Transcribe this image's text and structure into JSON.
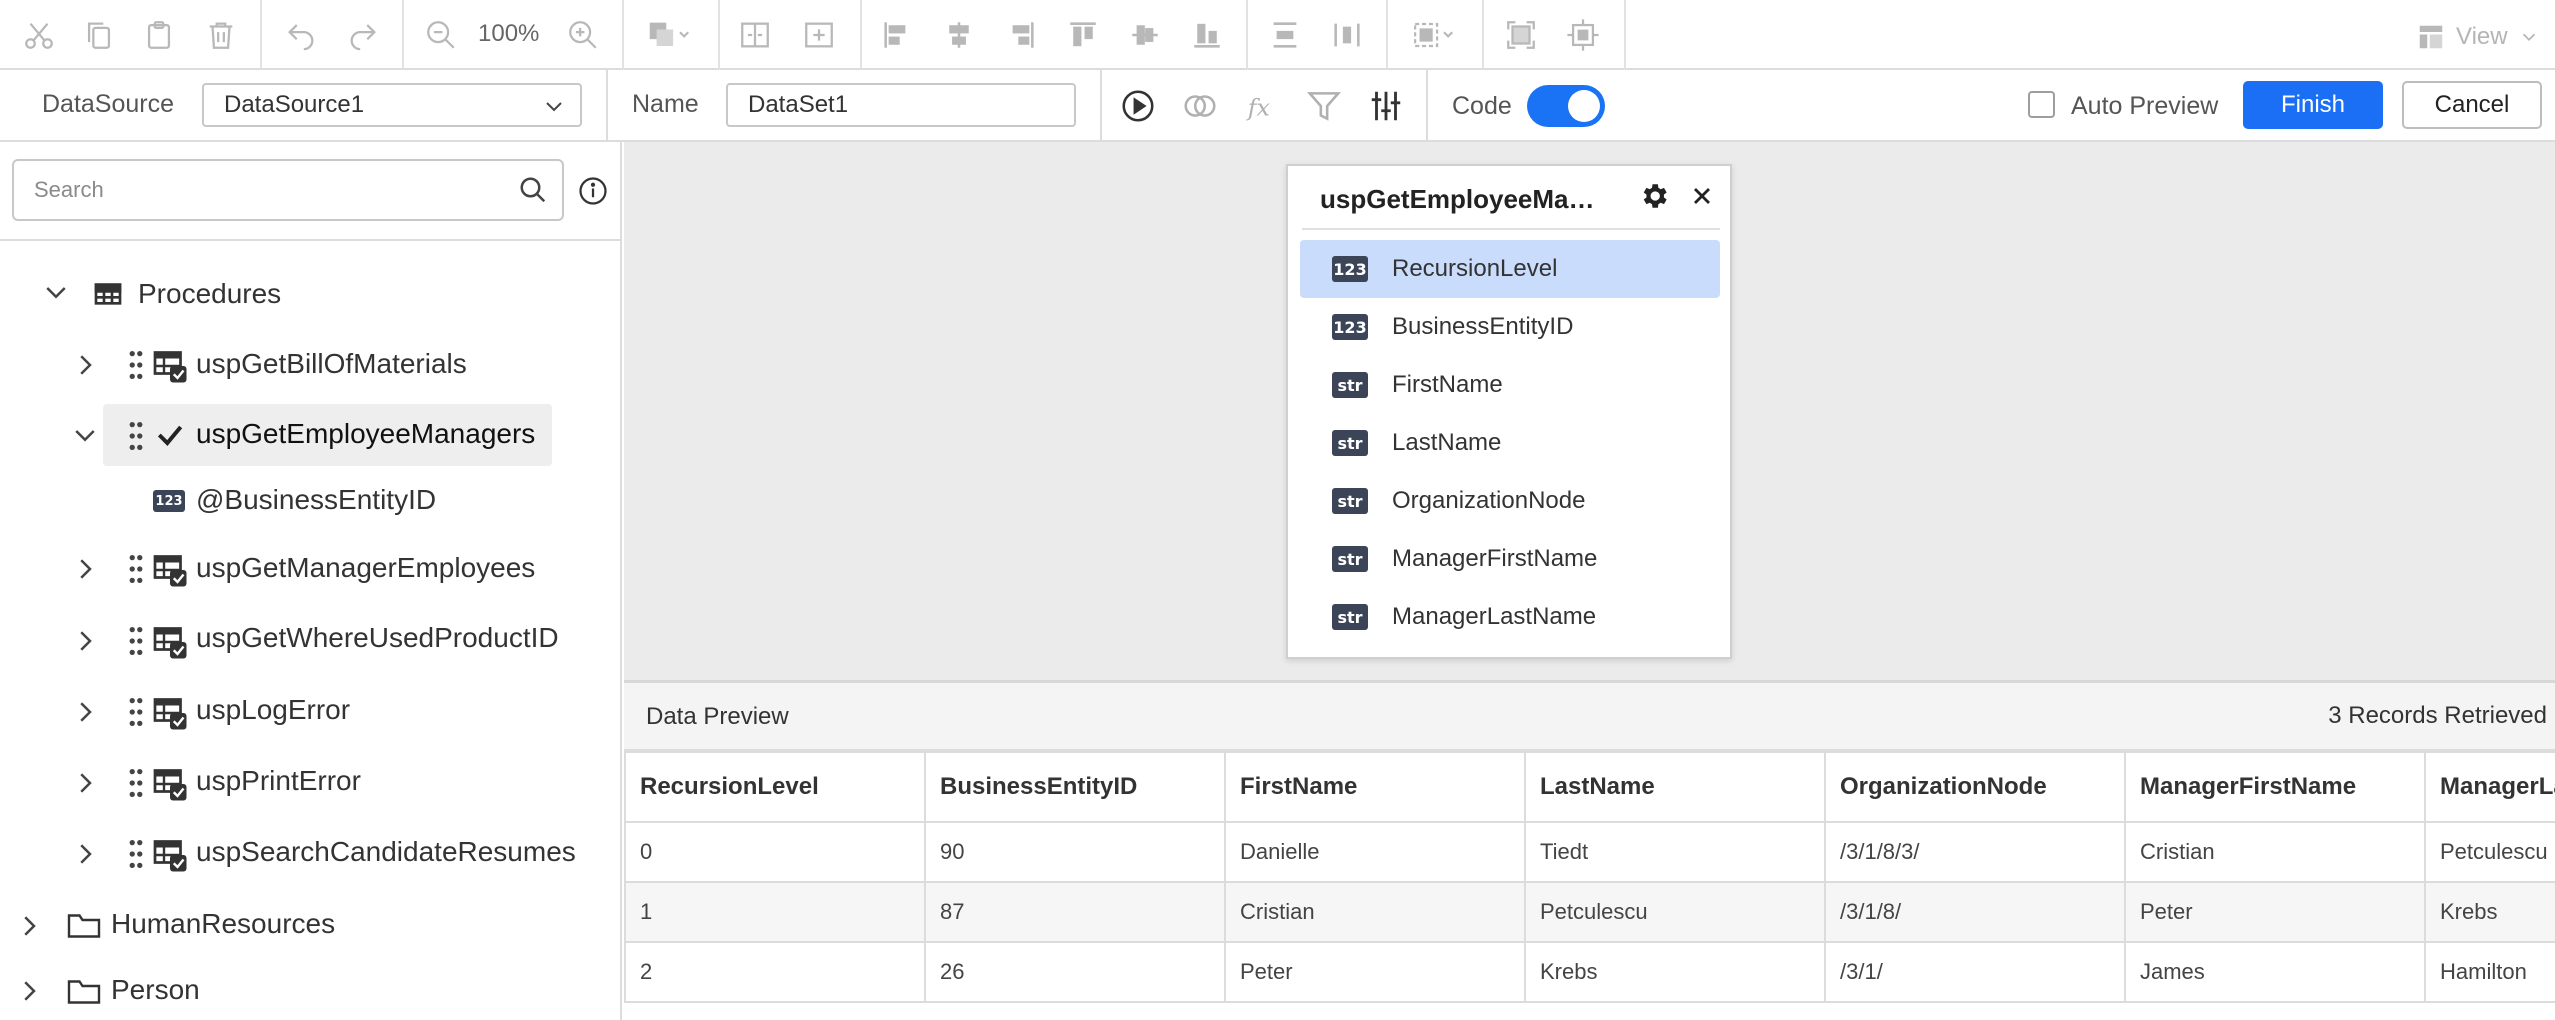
{
  "toolbar": {
    "zoom": "100%",
    "view_label": "View"
  },
  "datasource": {
    "label": "DataSource",
    "value": "DataSource1"
  },
  "name": {
    "label": "Name",
    "value": "DataSet1"
  },
  "code": {
    "label": "Code",
    "enabled": true
  },
  "auto_preview": {
    "label": "Auto Preview",
    "checked": false
  },
  "actions": {
    "finish": "Finish",
    "cancel": "Cancel"
  },
  "search": {
    "placeholder": "Search"
  },
  "tree": {
    "procedures_label": "Procedures",
    "items": [
      {
        "label": "uspGetBillOfMaterials"
      },
      {
        "label": "uspGetEmployeeManagers"
      },
      {
        "label": "@BusinessEntityID"
      },
      {
        "label": "uspGetManagerEmployees"
      },
      {
        "label": "uspGetWhereUsedProductID"
      },
      {
        "label": "uspLogError"
      },
      {
        "label": "uspPrintError"
      },
      {
        "label": "uspSearchCandidateResumes"
      }
    ],
    "folders": [
      {
        "label": "HumanResources"
      },
      {
        "label": "Person"
      }
    ],
    "param_badge": "123"
  },
  "query_card": {
    "title": "uspGetEmployeeManagers",
    "columns": [
      {
        "type": "123",
        "name": "RecursionLevel"
      },
      {
        "type": "123",
        "name": "BusinessEntityID"
      },
      {
        "type": "str",
        "name": "FirstName"
      },
      {
        "type": "str",
        "name": "LastName"
      },
      {
        "type": "str",
        "name": "OrganizationNode"
      },
      {
        "type": "str",
        "name": "ManagerFirstName"
      },
      {
        "type": "str",
        "name": "ManagerLastName"
      }
    ]
  },
  "preview": {
    "title": "Data Preview",
    "records": "3 Records Retrieved",
    "headers": [
      "RecursionLevel",
      "BusinessEntityID",
      "FirstName",
      "LastName",
      "OrganizationNode",
      "ManagerFirstName",
      "ManagerLastName"
    ],
    "rows": [
      [
        "0",
        "90",
        "Danielle",
        "Tiedt",
        "/3/1/8/3/",
        "Cristian",
        "Petculescu"
      ],
      [
        "1",
        "87",
        "Cristian",
        "Petculescu",
        "/3/1/8/",
        "Peter",
        "Krebs"
      ],
      [
        "2",
        "26",
        "Peter",
        "Krebs",
        "/3/1/",
        "James",
        "Hamilton"
      ]
    ]
  },
  "colors": {
    "accent": "#1a6ff5",
    "selection": "#c9dcfb",
    "canvas": "#ebebeb",
    "badge": "#3b4557"
  }
}
